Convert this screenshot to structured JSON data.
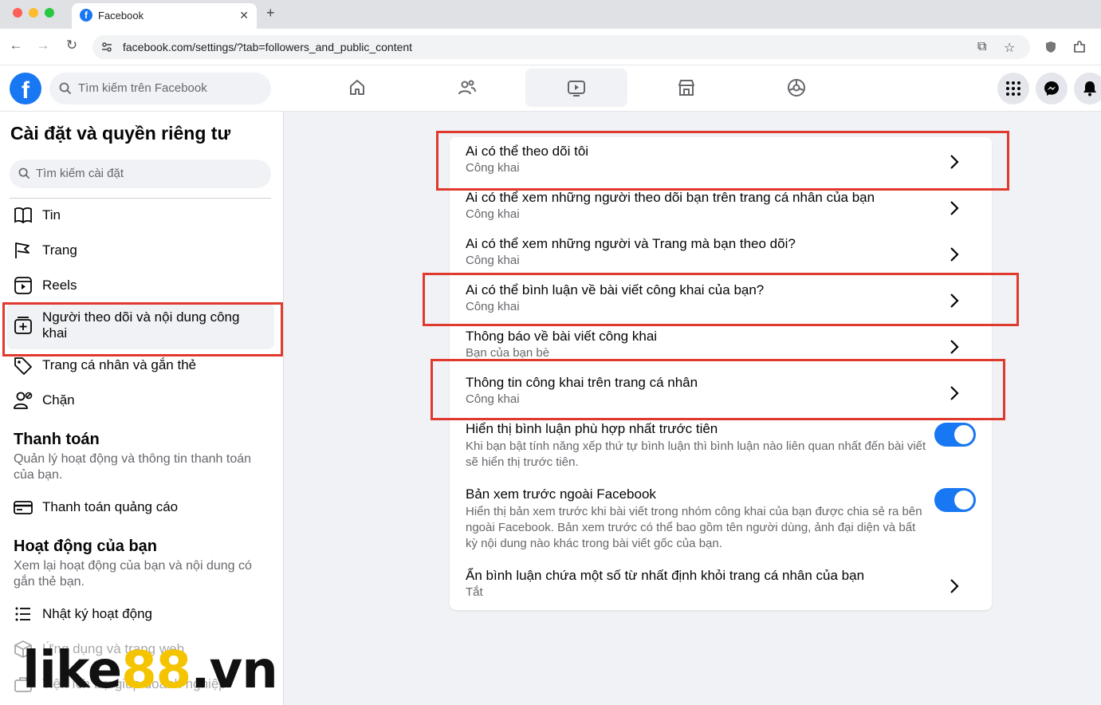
{
  "browser": {
    "tab_title": "Facebook",
    "tab_close": "✕",
    "new_tab": "+",
    "url": "facebook.com/settings/?tab=followers_and_public_content"
  },
  "header": {
    "logo": "f",
    "search_placeholder": "Tìm kiếm trên Facebook"
  },
  "sidebar": {
    "title": "Cài đặt và quyền riêng tư",
    "search_placeholder": "Tìm kiếm cài đặt",
    "items": [
      {
        "label": "Tin"
      },
      {
        "label": "Trang"
      },
      {
        "label": "Reels"
      },
      {
        "label": "Người theo dõi và nội dung công khai"
      },
      {
        "label": "Trang cá nhân và gắn thẻ"
      },
      {
        "label": "Chặn"
      }
    ],
    "payments": {
      "title": "Thanh toán",
      "desc": "Quản lý hoạt động và thông tin thanh toán của bạn.",
      "items": [
        {
          "label": "Thanh toán quảng cáo"
        }
      ]
    },
    "activity": {
      "title": "Hoạt động của bạn",
      "desc": "Xem lại hoạt động của bạn và nội dung có gắn thẻ bạn.",
      "items": [
        {
          "label": "Nhật ký hoạt động"
        },
        {
          "label": "Ứng dụng và trang web"
        },
        {
          "label": "Tiện ích trợ giúp doanh nghiệp"
        }
      ]
    }
  },
  "settings": [
    {
      "title": "Ai có thể theo dõi tôi",
      "value": "Công khai"
    },
    {
      "title": "Ai có thể xem những người theo dõi bạn trên trang cá nhân của bạn",
      "value": "Công khai"
    },
    {
      "title": "Ai có thể xem những người và Trang mà bạn theo dõi?",
      "value": "Công khai"
    },
    {
      "title": "Ai có thể bình luận về bài viết công khai của bạn?",
      "value": "Công khai"
    },
    {
      "title": "Thông báo về bài viết công khai",
      "value": "Bạn của bạn bè"
    },
    {
      "title": "Thông tin công khai trên trang cá nhân",
      "value": "Công khai"
    }
  ],
  "toggles": [
    {
      "title": "Hiển thị bình luận phù hợp nhất trước tiên",
      "desc": "Khi bạn bật tính năng xếp thứ tự bình luận thì bình luận nào liên quan nhất đến bài viết sẽ hiển thị trước tiên.",
      "on": true
    },
    {
      "title": "Bản xem trước ngoài Facebook",
      "desc": "Hiển thị bản xem trước khi bài viết trong nhóm công khai của bạn được chia sẻ ra bên ngoài Facebook. Bản xem trước có thể bao gồm tên người dùng, ảnh đại diện và bất kỳ nội dung nào khác trong bài viết gốc của bạn.",
      "on": true
    }
  ],
  "hide_comments": {
    "title": "Ẩn bình luận chứa một số từ nhất định khỏi trang cá nhân của bạn",
    "value": "Tắt"
  },
  "watermark": {
    "part1": "like",
    "part2": "88",
    "part3": ".vn"
  },
  "colors": {
    "accent": "#1877f2",
    "highlight": "#e03a2f"
  }
}
